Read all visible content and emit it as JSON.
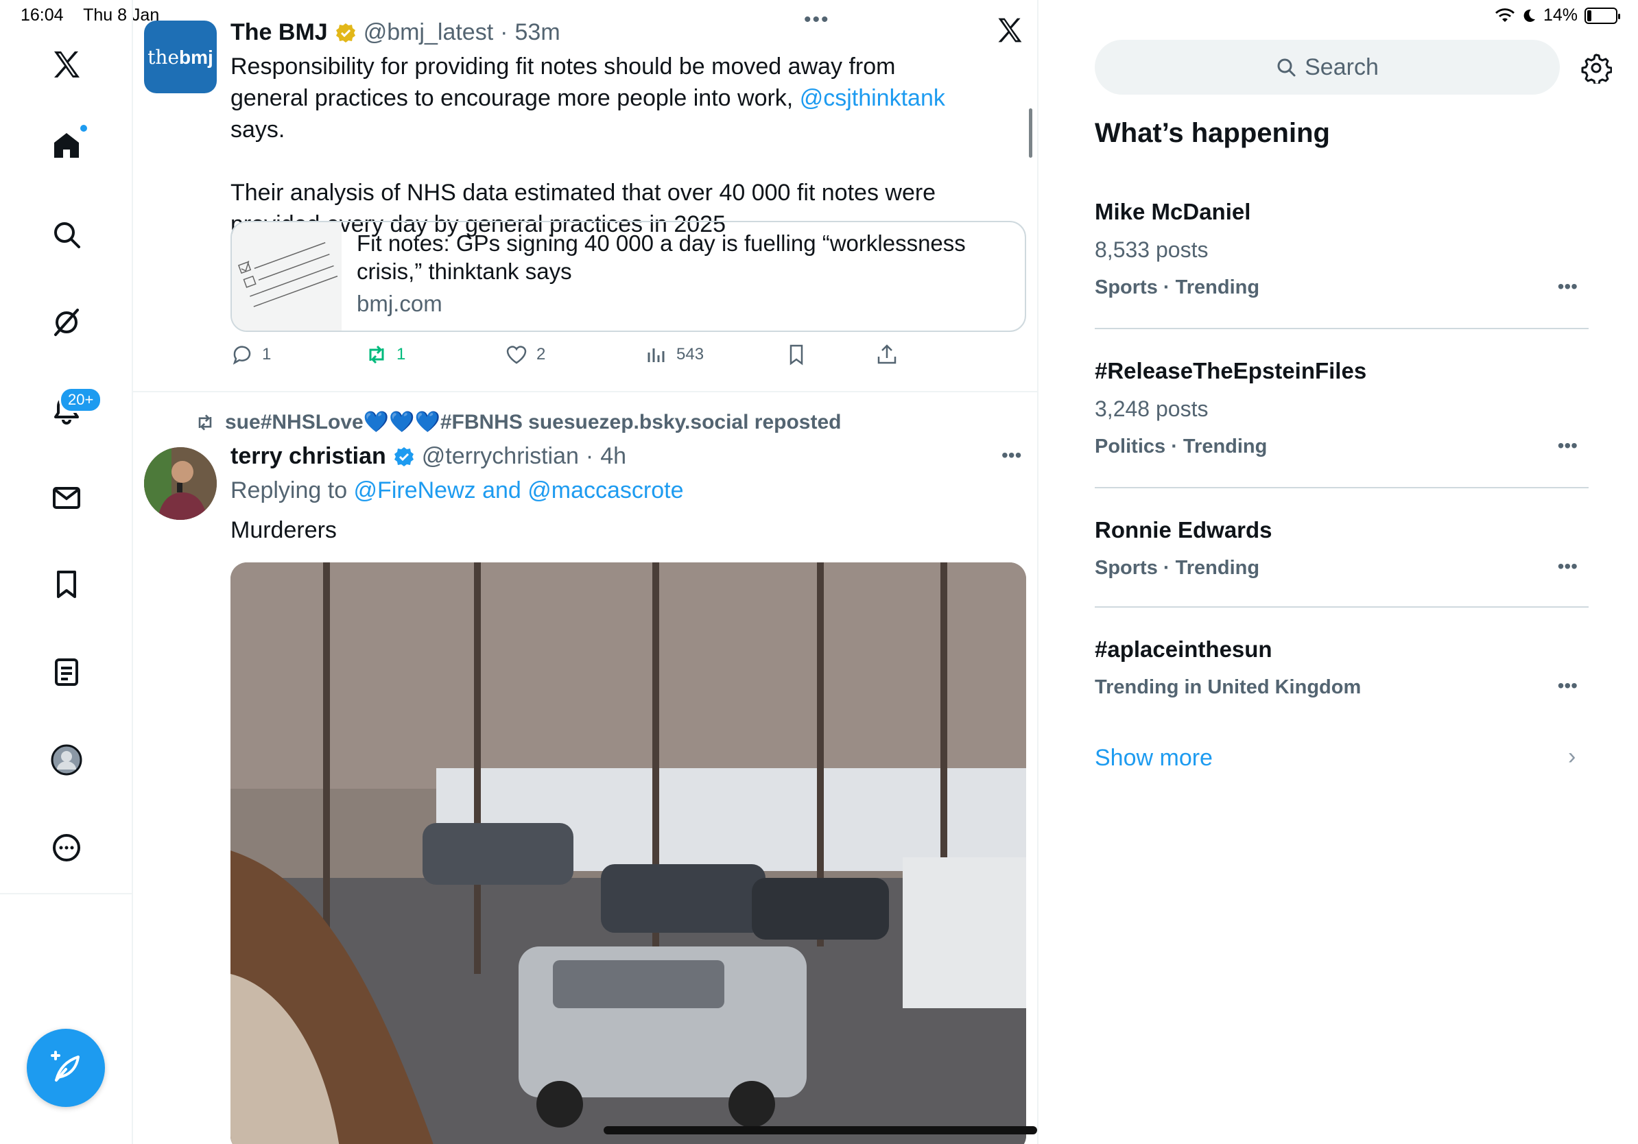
{
  "status_bar": {
    "time": "16:04",
    "date": "Thu 8 Jan",
    "battery": "14%",
    "battery_level": 0.14
  },
  "nav": {
    "notifications_badge": "20+",
    "items": [
      "x-logo",
      "home",
      "explore",
      "grok",
      "notifications",
      "messages",
      "bookmarks",
      "lists",
      "profile",
      "more"
    ]
  },
  "timeline": {
    "tweet1": {
      "avatar_text_regular": "the",
      "avatar_text_bold": "bmj",
      "name": "The BMJ",
      "handle": "@bmj_latest",
      "dot": "·",
      "time": "53m",
      "text_part1": "Responsibility for providing fit notes should be moved away from general practices to encourage more people into work, ",
      "mention": "@csjthinktank",
      "text_part2": " says.",
      "text_para2": "Their analysis of NHS data estimated that over 40 000 fit notes were provided every day by general practices in 2025",
      "card": {
        "title": "Fit notes: GPs signing 40 000 a day is fuelling “worklessness crisis,” thinktank says",
        "domain": "bmj.com"
      },
      "actions": {
        "replies": "1",
        "reposts": "1",
        "likes": "2",
        "views": "543"
      }
    },
    "tweet2": {
      "repost_prefix": "sue#NHSLove",
      "repost_hearts": "💙💙💙",
      "repost_suffix": "#FBNHS suesuezep.bsky.social reposted",
      "name": "terry christian",
      "handle": "@terrychristian",
      "dot": "·",
      "time": "4h",
      "replying_label": "Replying to ",
      "replying_to": "@FireNewz and @maccascrote",
      "text": "Murderers"
    }
  },
  "sidebar": {
    "search_placeholder": "Search",
    "section_title": "What’s happening",
    "trends": [
      {
        "name": "Mike McDaniel",
        "posts": "8,533 posts",
        "category": "Sports · Trending"
      },
      {
        "name": "#ReleaseTheEpsteinFiles",
        "posts": "3,248 posts",
        "category": "Politics · Trending"
      },
      {
        "name": "Ronnie Edwards",
        "posts": "",
        "category": "Sports · Trending"
      },
      {
        "name": "#aplaceinthesun",
        "posts": "",
        "category": "Trending in United Kingdom"
      }
    ],
    "show_more": "Show more"
  },
  "colors": {
    "accent": "#1d9bf0",
    "repost_green": "#00ba7c",
    "muted": "#536471",
    "bmj_blue": "#1e6fb5"
  }
}
